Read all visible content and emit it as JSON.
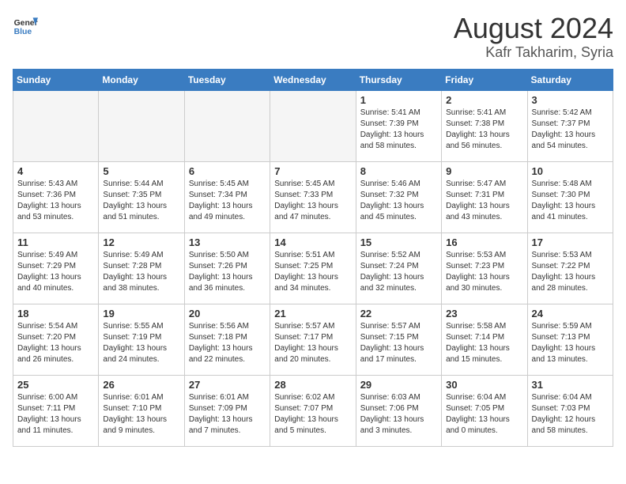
{
  "logo": {
    "general": "General",
    "blue": "Blue"
  },
  "title": {
    "month": "August 2024",
    "location": "Kafr Takharim, Syria"
  },
  "headers": [
    "Sunday",
    "Monday",
    "Tuesday",
    "Wednesday",
    "Thursday",
    "Friday",
    "Saturday"
  ],
  "weeks": [
    [
      {
        "day": "",
        "empty": true
      },
      {
        "day": "",
        "empty": true
      },
      {
        "day": "",
        "empty": true
      },
      {
        "day": "",
        "empty": true
      },
      {
        "day": "1",
        "sunrise": "5:41 AM",
        "sunset": "7:39 PM",
        "daylight": "13 hours and 58 minutes."
      },
      {
        "day": "2",
        "sunrise": "5:41 AM",
        "sunset": "7:38 PM",
        "daylight": "13 hours and 56 minutes."
      },
      {
        "day": "3",
        "sunrise": "5:42 AM",
        "sunset": "7:37 PM",
        "daylight": "13 hours and 54 minutes."
      }
    ],
    [
      {
        "day": "4",
        "sunrise": "5:43 AM",
        "sunset": "7:36 PM",
        "daylight": "13 hours and 53 minutes."
      },
      {
        "day": "5",
        "sunrise": "5:44 AM",
        "sunset": "7:35 PM",
        "daylight": "13 hours and 51 minutes."
      },
      {
        "day": "6",
        "sunrise": "5:45 AM",
        "sunset": "7:34 PM",
        "daylight": "13 hours and 49 minutes."
      },
      {
        "day": "7",
        "sunrise": "5:45 AM",
        "sunset": "7:33 PM",
        "daylight": "13 hours and 47 minutes."
      },
      {
        "day": "8",
        "sunrise": "5:46 AM",
        "sunset": "7:32 PM",
        "daylight": "13 hours and 45 minutes."
      },
      {
        "day": "9",
        "sunrise": "5:47 AM",
        "sunset": "7:31 PM",
        "daylight": "13 hours and 43 minutes."
      },
      {
        "day": "10",
        "sunrise": "5:48 AM",
        "sunset": "7:30 PM",
        "daylight": "13 hours and 41 minutes."
      }
    ],
    [
      {
        "day": "11",
        "sunrise": "5:49 AM",
        "sunset": "7:29 PM",
        "daylight": "13 hours and 40 minutes."
      },
      {
        "day": "12",
        "sunrise": "5:49 AM",
        "sunset": "7:28 PM",
        "daylight": "13 hours and 38 minutes."
      },
      {
        "day": "13",
        "sunrise": "5:50 AM",
        "sunset": "7:26 PM",
        "daylight": "13 hours and 36 minutes."
      },
      {
        "day": "14",
        "sunrise": "5:51 AM",
        "sunset": "7:25 PM",
        "daylight": "13 hours and 34 minutes."
      },
      {
        "day": "15",
        "sunrise": "5:52 AM",
        "sunset": "7:24 PM",
        "daylight": "13 hours and 32 minutes."
      },
      {
        "day": "16",
        "sunrise": "5:53 AM",
        "sunset": "7:23 PM",
        "daylight": "13 hours and 30 minutes."
      },
      {
        "day": "17",
        "sunrise": "5:53 AM",
        "sunset": "7:22 PM",
        "daylight": "13 hours and 28 minutes."
      }
    ],
    [
      {
        "day": "18",
        "sunrise": "5:54 AM",
        "sunset": "7:20 PM",
        "daylight": "13 hours and 26 minutes."
      },
      {
        "day": "19",
        "sunrise": "5:55 AM",
        "sunset": "7:19 PM",
        "daylight": "13 hours and 24 minutes."
      },
      {
        "day": "20",
        "sunrise": "5:56 AM",
        "sunset": "7:18 PM",
        "daylight": "13 hours and 22 minutes."
      },
      {
        "day": "21",
        "sunrise": "5:57 AM",
        "sunset": "7:17 PM",
        "daylight": "13 hours and 20 minutes."
      },
      {
        "day": "22",
        "sunrise": "5:57 AM",
        "sunset": "7:15 PM",
        "daylight": "13 hours and 17 minutes."
      },
      {
        "day": "23",
        "sunrise": "5:58 AM",
        "sunset": "7:14 PM",
        "daylight": "13 hours and 15 minutes."
      },
      {
        "day": "24",
        "sunrise": "5:59 AM",
        "sunset": "7:13 PM",
        "daylight": "13 hours and 13 minutes."
      }
    ],
    [
      {
        "day": "25",
        "sunrise": "6:00 AM",
        "sunset": "7:11 PM",
        "daylight": "13 hours and 11 minutes."
      },
      {
        "day": "26",
        "sunrise": "6:01 AM",
        "sunset": "7:10 PM",
        "daylight": "13 hours and 9 minutes."
      },
      {
        "day": "27",
        "sunrise": "6:01 AM",
        "sunset": "7:09 PM",
        "daylight": "13 hours and 7 minutes."
      },
      {
        "day": "28",
        "sunrise": "6:02 AM",
        "sunset": "7:07 PM",
        "daylight": "13 hours and 5 minutes."
      },
      {
        "day": "29",
        "sunrise": "6:03 AM",
        "sunset": "7:06 PM",
        "daylight": "13 hours and 3 minutes."
      },
      {
        "day": "30",
        "sunrise": "6:04 AM",
        "sunset": "7:05 PM",
        "daylight": "13 hours and 0 minutes."
      },
      {
        "day": "31",
        "sunrise": "6:04 AM",
        "sunset": "7:03 PM",
        "daylight": "12 hours and 58 minutes."
      }
    ]
  ]
}
